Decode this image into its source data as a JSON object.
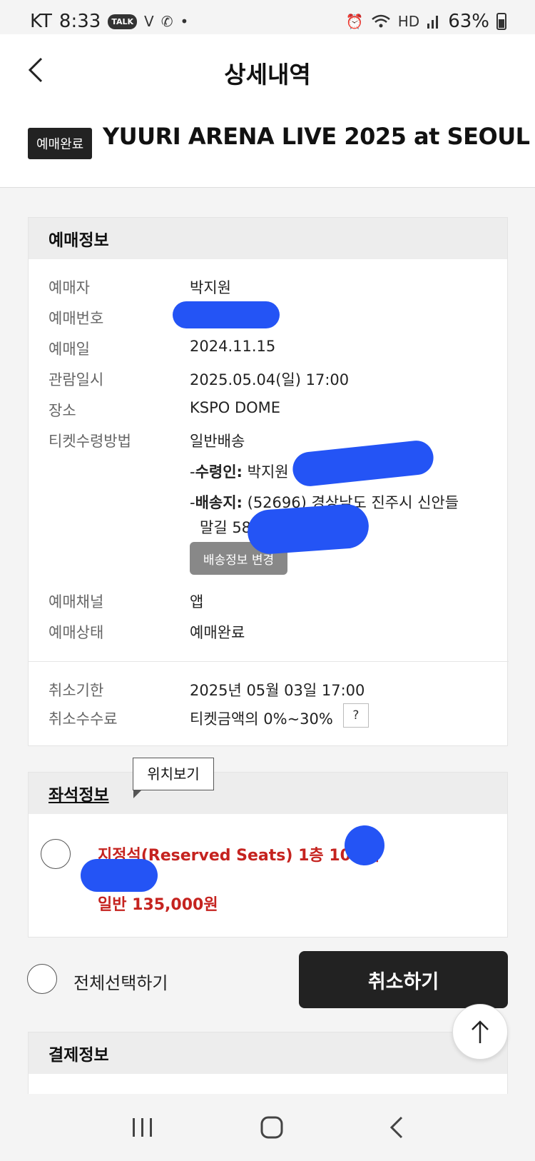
{
  "status_bar": {
    "carrier": "KT",
    "time": "8:33",
    "notif_talk": "TALK",
    "battery": "63%"
  },
  "header": {
    "title": "상세내역",
    "badge": "예매완료",
    "event_title": "YUURI ARENA LIVE 2025 at SEOUL"
  },
  "booking_info": {
    "heading": "예매정보",
    "rows": [
      {
        "label": "예매자",
        "value": "박지원"
      },
      {
        "label": "예매번호",
        "value": ""
      },
      {
        "label": "예매일",
        "value": "2024.11.15"
      },
      {
        "label": "관람일시",
        "value": "2025.05.04(일) 17:00"
      },
      {
        "label": "장소",
        "value": "KSPO DOME"
      },
      {
        "label": "티켓수령방법",
        "value": "일반배송"
      }
    ],
    "recipient_label": "수령인:",
    "recipient_value": "박지원",
    "address_label": "배송지:",
    "address_value": "(52696) 경상남도 진주시 신안들",
    "address_line2": "말길 58",
    "change_delivery_button": "배송정보 변경",
    "rows2": [
      {
        "label": "예매채널",
        "value": "앱"
      },
      {
        "label": "예매상태",
        "value": "예매완료"
      }
    ],
    "cancel_rows": [
      {
        "label": "취소기한",
        "value": "2025년 05월 03일 17:00"
      },
      {
        "label": "취소수수료",
        "value": "티켓금액의 0%~30%"
      }
    ],
    "help_label": "?"
  },
  "seat_info": {
    "heading": "좌석정보",
    "tooltip": "위치보기",
    "seat_line": "지정석(Reserved Seats) 1층 10구역",
    "price_line": "일반 135,000원"
  },
  "actions": {
    "select_all": "전체선택하기",
    "cancel": "취소하기"
  },
  "payment_info": {
    "heading": "결제정보"
  },
  "colors": {
    "accent_red": "#c5231f",
    "dark": "#222222",
    "redaction_blue": "#2454f5"
  }
}
